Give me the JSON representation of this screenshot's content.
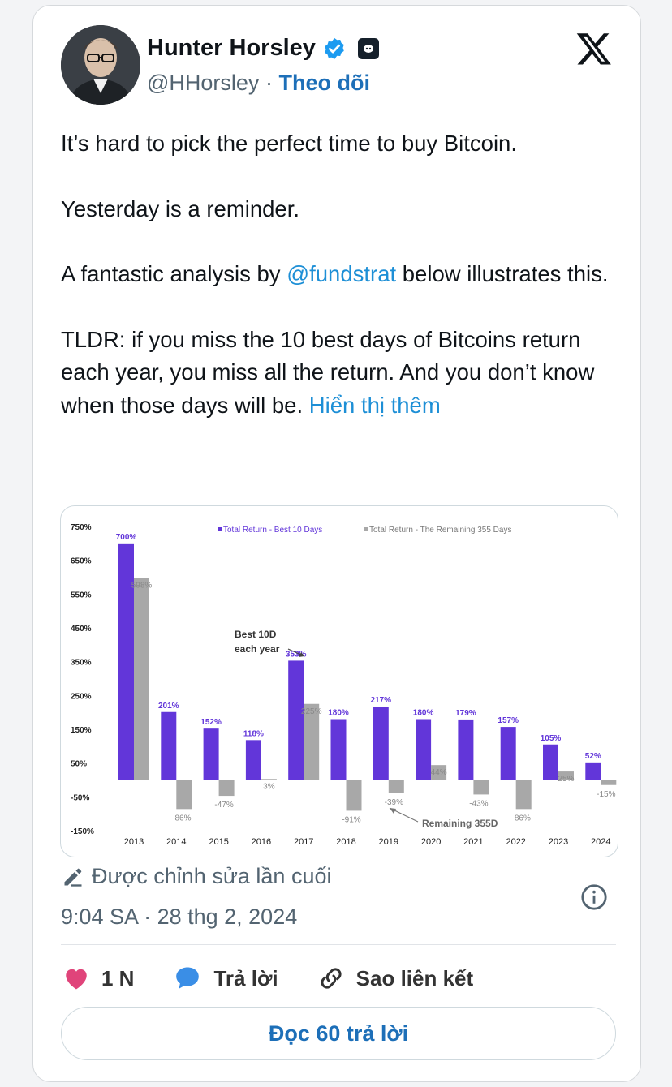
{
  "author": {
    "name": "Hunter Horsley",
    "handle": "@HHorsley",
    "separator": "·",
    "follow_label": "Theo dõi"
  },
  "tweet": {
    "p1": "It’s hard to pick the perfect time to buy Bitcoin.",
    "p2": "Yesterday is a reminder.",
    "p3_before": "A fantastic analysis by ",
    "p3_mention": "@fundstrat",
    "p3_after": " below illustrates this.",
    "p4": "TLDR: if you miss the 10 best days of Bitcoins return each year, you miss all the return. And you don’t know when those days will be. ",
    "show_more": "Hiển thị thêm"
  },
  "meta": {
    "edited_label": "Được chỉnh sửa lần cuối",
    "timestamp": "9:04 SA · 28 thg 2, 2024"
  },
  "actions": {
    "likes": "1 N",
    "reply": "Trả lời",
    "copy_link": "Sao liên kết",
    "read_replies": "Đọc 60 trả lời"
  },
  "colors": {
    "purple": "#6236d9",
    "gray": "#a8a8a8",
    "like": "#e0447a",
    "reply": "#3a8ee6",
    "link": "#1d8fd6"
  },
  "chart_data": {
    "type": "bar",
    "categories": [
      "2013",
      "2014",
      "2015",
      "2016",
      "2017",
      "2018",
      "2019",
      "2020",
      "2021",
      "2022",
      "2023",
      "2024"
    ],
    "series": [
      {
        "name": "Total Return - Best 10 Days",
        "values": [
          700,
          201,
          152,
          118,
          353,
          180,
          217,
          180,
          179,
          157,
          105,
          52
        ],
        "labels": [
          "700%",
          "201%",
          "152%",
          "118%",
          "353%",
          "180%",
          "217%",
          "180%",
          "179%",
          "157%",
          "105%",
          "52%"
        ]
      },
      {
        "name": "Total Return - The Remaining 355 Days",
        "values": [
          598,
          -86,
          -47,
          3,
          225,
          -91,
          -39,
          44,
          -43,
          -86,
          25,
          -15
        ],
        "labels": [
          "598%",
          "-86%",
          "-47%",
          "3%",
          "225%",
          "-91%",
          "-39%",
          "44%",
          "-43%",
          "-86%",
          "25%",
          "-15%"
        ]
      }
    ],
    "ylim": [
      -150,
      750
    ],
    "yticks": [
      "750%",
      "650%",
      "550%",
      "450%",
      "350%",
      "250%",
      "150%",
      "50%",
      "-50%",
      "-150%"
    ],
    "annotations": {
      "best": "Best 10D each year",
      "remaining": "Remaining 355D"
    },
    "legend": "top"
  }
}
